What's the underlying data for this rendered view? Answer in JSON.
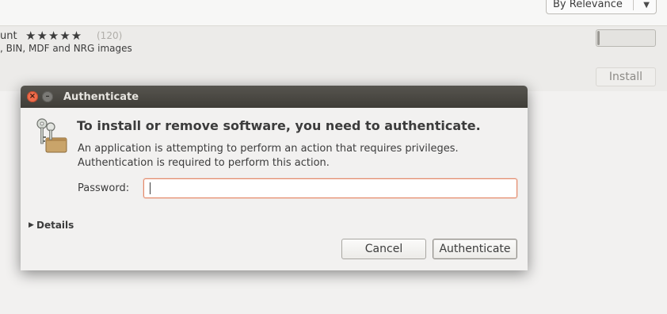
{
  "background": {
    "sort_dropdown": {
      "selected": "By Relevance",
      "arrow_icon": "chevron-down-icon"
    },
    "app_row": {
      "name_fragment": "unt",
      "stars": "★★★★★",
      "rating_count": "(120)",
      "description_fragment": ", BIN, MDF and NRG images",
      "progress_fraction": 0.04,
      "install_label": "Install"
    }
  },
  "dialog": {
    "title": "Authenticate",
    "close_icon": "×",
    "minimize_icon": "–",
    "icon": "keys-icon",
    "headline": "To install or remove software, you need to authenticate.",
    "message_line1": "An application is attempting to perform an action that requires privileges.",
    "message_line2": "Authentication is required to perform this action.",
    "password_label": "Password:",
    "password_value": "",
    "details_label": "Details",
    "details_arrow": "▶",
    "cancel_label": "Cancel",
    "authenticate_label": "Authenticate"
  },
  "colors": {
    "titlebar": "#3f3d38",
    "close_button": "#ef6c4b",
    "input_focus_border": "#e58a6a",
    "window_bg": "#f2f1f0"
  }
}
